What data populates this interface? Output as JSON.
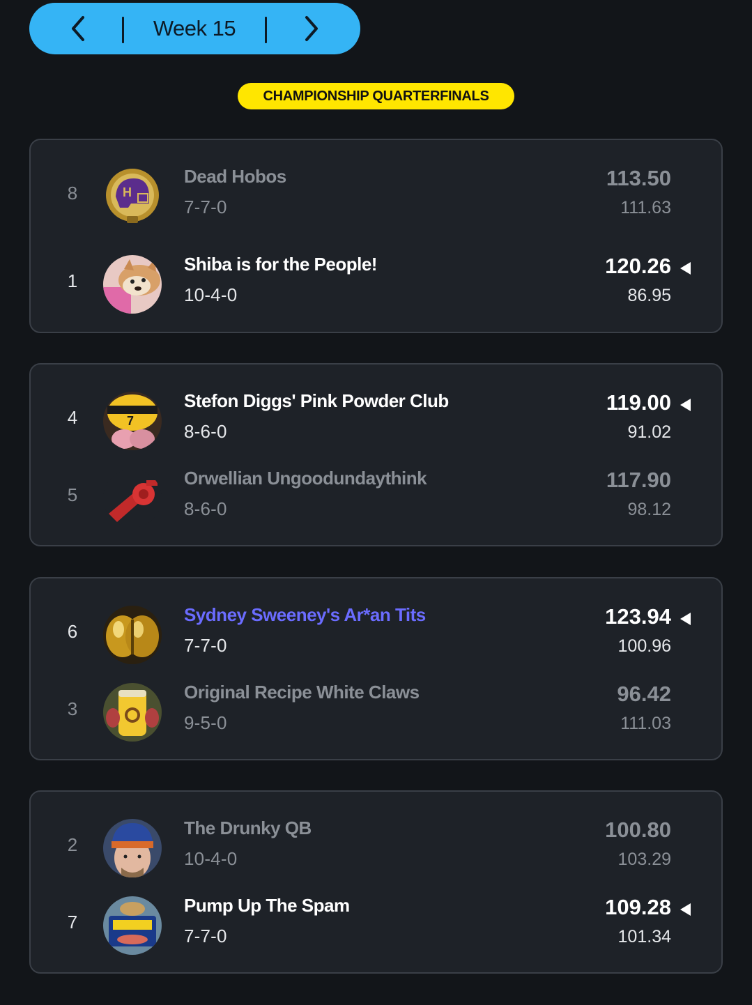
{
  "nav": {
    "week_label": "Week 15"
  },
  "round": {
    "label": "CHAMPIONSHIP QUARTERFINALS"
  },
  "colors": {
    "nav_bg": "#35b4f5",
    "badge_bg": "#ffe600",
    "card_bg": "#1e2228",
    "my_team": "#6b6cff",
    "page_bg": "#121519"
  },
  "matchups": [
    {
      "teams": [
        {
          "seed": "8",
          "name": "Dead Hobos",
          "record": "7-7-0",
          "score": "113.50",
          "projected": "111.63",
          "winner": false,
          "avatar": "dead-hobos-helmet-logo"
        },
        {
          "seed": "1",
          "name": "Shiba is for the People!",
          "record": "10-4-0",
          "score": "120.26",
          "projected": "86.95",
          "winner": true,
          "avatar": "shiba-dog-photo"
        }
      ]
    },
    {
      "teams": [
        {
          "seed": "4",
          "name": "Stefon Diggs' Pink Powder Club",
          "record": "8-6-0",
          "score": "119.00",
          "projected": "91.02",
          "winner": true,
          "avatar": "yellow-beanie-photo"
        },
        {
          "seed": "5",
          "name": "Orwellian Ungoodundaythink",
          "record": "8-6-0",
          "score": "117.90",
          "projected": "98.12",
          "winner": false,
          "avatar": "red-whistle-icon"
        }
      ]
    },
    {
      "teams": [
        {
          "seed": "6",
          "name": "Sydney Sweeney's Ar*an Tits",
          "record": "7-7-0",
          "score": "123.94",
          "projected": "100.96",
          "winner": true,
          "avatar": "gold-sphere-photo",
          "is_mine": true
        },
        {
          "seed": "3",
          "name": "Original Recipe White Claws",
          "record": "9-5-0",
          "score": "96.42",
          "projected": "111.03",
          "winner": false,
          "avatar": "yellow-can-photo"
        }
      ]
    },
    {
      "teams": [
        {
          "seed": "2",
          "name": "The Drunky QB",
          "record": "10-4-0",
          "score": "100.80",
          "projected": "103.29",
          "winner": false,
          "avatar": "man-beanie-photo"
        },
        {
          "seed": "7",
          "name": "Pump Up The Spam",
          "record": "7-7-0",
          "score": "109.28",
          "projected": "101.34",
          "winner": true,
          "avatar": "spam-can-photo"
        }
      ]
    }
  ]
}
